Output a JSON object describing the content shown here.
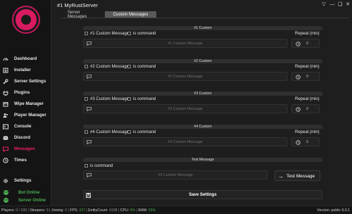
{
  "window": {
    "title": "#1 MyRustServer",
    "minimize": "—",
    "restore": "❏",
    "close": "✕",
    "pin": "▽"
  },
  "logo_text": "MY RUST SERVER",
  "sidebar": {
    "items": [
      {
        "label": "Dashboard",
        "icon": "dashboard-icon"
      },
      {
        "label": "Installer",
        "icon": "installer-icon"
      },
      {
        "label": "Server Settings",
        "icon": "wrench-icon"
      },
      {
        "label": "Plugins",
        "icon": "plugin-icon"
      },
      {
        "label": "Wipe Manager",
        "icon": "calendar-icon"
      },
      {
        "label": "Player Manager",
        "icon": "users-icon"
      },
      {
        "label": "Console",
        "icon": "console-icon"
      },
      {
        "label": "Discord",
        "icon": "discord-icon"
      },
      {
        "label": "Messages",
        "icon": "message-icon",
        "active": true
      },
      {
        "label": "Times",
        "icon": "clock-icon"
      },
      {
        "label": "Settings",
        "icon": "gear-icon"
      }
    ],
    "bot_status": "Bot Online",
    "server_status": "Server Online",
    "online_color": "#4caf50"
  },
  "tabs": [
    {
      "label": "Server Messages",
      "active": false
    },
    {
      "label": "Custom Messages",
      "active": true
    }
  ],
  "custom": [
    {
      "title": "#1 Custom",
      "label": "#1 Custom Message",
      "cmd": "is command",
      "placeholder": "#1 Custom Message",
      "repeat_label": "Repeat (min)",
      "repeat": "0"
    },
    {
      "title": "#2 Custom",
      "label": "#2 Custom Message",
      "cmd": "is command",
      "placeholder": "#2 Custom Message",
      "repeat_label": "Repeat (min)",
      "repeat": "0"
    },
    {
      "title": "#3 Custom",
      "label": "#3 Custom Message",
      "cmd": "is command",
      "placeholder": "#3 Custom Message",
      "repeat_label": "Repeat (min)",
      "repeat": "0"
    },
    {
      "title": "#4 Custom",
      "label": "#4 Custom Message",
      "cmd": "is command",
      "placeholder": "#4 Custom Message",
      "repeat_label": "Repeat (min)",
      "repeat": "0"
    }
  ],
  "test": {
    "title": "Test Message",
    "cmd": "is command",
    "placeholder": "#4 Custom Message",
    "button": "Test Message"
  },
  "save_label": "Save Settings",
  "statusbar": {
    "players_label": "Players:",
    "players": "0 / 100",
    "sleepers_label": "Sleepers:",
    "sleepers": "0",
    "joining_label": "Joining:",
    "joining": "0",
    "fps_label": "FPS:",
    "fps": "237",
    "entity_label": "EntityCount:",
    "entity": "4108",
    "cpu_label": "CPU:",
    "cpu": "6%",
    "ram_label": "RAM:",
    "ram": "26%",
    "version": "Version: public 6.0.1"
  },
  "accent": "#e91e63"
}
